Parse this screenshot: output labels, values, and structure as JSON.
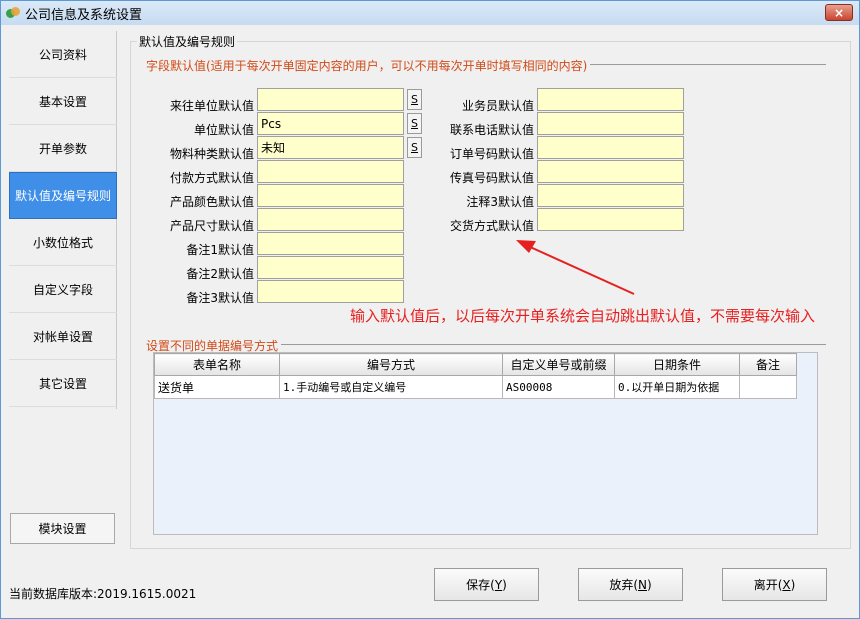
{
  "window": {
    "title": "公司信息及系统设置",
    "close_label": "×"
  },
  "sidebar": {
    "items": [
      {
        "label": "公司资料"
      },
      {
        "label": "基本设置"
      },
      {
        "label": "开单参数"
      },
      {
        "label": "默认值及编号规则"
      },
      {
        "label": "小数位格式"
      },
      {
        "label": "自定义字段"
      },
      {
        "label": "对帐单设置"
      },
      {
        "label": "其它设置"
      }
    ],
    "active_index": 3,
    "module_button": "模块设置"
  },
  "panel": {
    "title": "默认值及编号规则",
    "defaults_group": "字段默认值(适用于每次开单固定内容的用户，可以不用每次开单时填写相同的内容)",
    "left_fields": [
      {
        "label": "来往单位默认值",
        "value": "",
        "s_button": "S"
      },
      {
        "label": "单位默认值",
        "value": "Pcs",
        "s_button": "S"
      },
      {
        "label": "物料种类默认值",
        "value": "未知",
        "s_button": "S"
      },
      {
        "label": "付款方式默认值",
        "value": ""
      },
      {
        "label": "产品颜色默认值",
        "value": ""
      },
      {
        "label": "产品尺寸默认值",
        "value": ""
      },
      {
        "label": "备注1默认值",
        "value": ""
      },
      {
        "label": "备注2默认值",
        "value": ""
      },
      {
        "label": "备注3默认值",
        "value": ""
      }
    ],
    "right_fields": [
      {
        "label": "业务员默认值",
        "value": ""
      },
      {
        "label": "联系电话默认值",
        "value": ""
      },
      {
        "label": "订单号码默认值",
        "value": ""
      },
      {
        "label": "传真号码默认值",
        "value": ""
      },
      {
        "label": "注释3默认值",
        "value": ""
      },
      {
        "label": "交货方式默认值",
        "value": ""
      }
    ],
    "annotation": "输入默认值后，以后每次开单系统会自动跳出默认值，不需要每次输入",
    "numbering_group": "设置不同的单据编号方式",
    "table": {
      "headers": [
        "表单名称",
        "编号方式",
        "自定义单号或前缀",
        "日期条件",
        "备注"
      ],
      "rows": [
        [
          "送货单",
          "1.手动编号或自定义编号",
          "AS00008",
          "0.以开单日期为依据",
          ""
        ]
      ]
    }
  },
  "footer": {
    "version_text": "当前数据库版本:2019.1615.0021",
    "save": {
      "label": "保存(",
      "key": "Y",
      "end": ")"
    },
    "discard": {
      "label": "放弃(",
      "key": "N",
      "end": ")"
    },
    "leave": {
      "label": "离开(",
      "key": "X",
      "end": ")"
    }
  },
  "colors": {
    "accent": "#3f8ee8",
    "field_bg": "#ffffcc",
    "legend": "#d24a16",
    "annotation": "#e62020"
  }
}
